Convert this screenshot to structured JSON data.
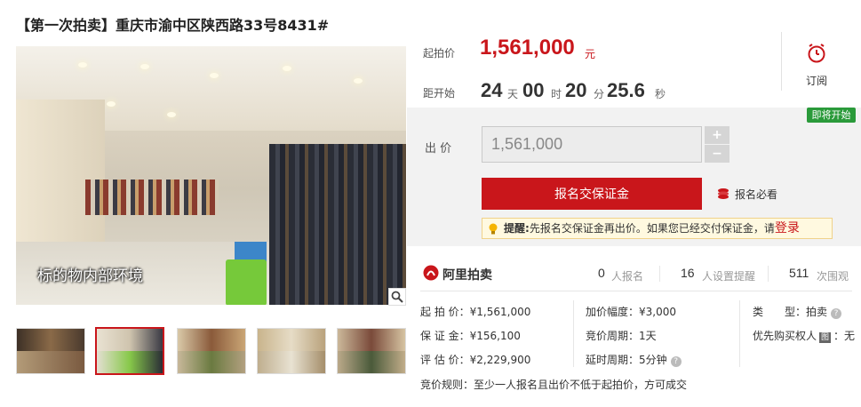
{
  "title": "【第一次拍卖】重庆市渝中区陕西路33号8431#",
  "photo": {
    "caption": "标的物内部环境"
  },
  "starting_price": {
    "label": "起拍价",
    "value": "1,561,000",
    "unit": "元"
  },
  "countdown": {
    "label": "距开始",
    "days": "24",
    "days_unit": "天",
    "hours": "00",
    "hours_unit": "时",
    "minutes": "20",
    "minutes_unit": "分",
    "seconds": "25.6",
    "seconds_unit": "秒"
  },
  "subscribe": {
    "label": "订阅",
    "icon": "alarm-clock-icon"
  },
  "status_badge": "即将开始",
  "bid": {
    "label": "出 价",
    "value": "1,561,000",
    "plus": "+",
    "minus": "−",
    "register_button": "报名交保证金",
    "must_see": "报名必看"
  },
  "tip": {
    "prefix": "提醒:",
    "text": "先报名交保证金再出价。如果您已经交付保证金，请",
    "login": "登录"
  },
  "platform": {
    "name": "阿里拍卖"
  },
  "stats": [
    {
      "num": "0",
      "label": "人报名"
    },
    {
      "num": "16",
      "label": "人设置提醒"
    },
    {
      "num": "511",
      "label": "次围观"
    }
  ],
  "details": {
    "start_price": {
      "k": "起 拍 价：",
      "v": "¥1,561,000"
    },
    "deposit": {
      "k": "保 证 金：",
      "v": "¥156,100"
    },
    "appraisal": {
      "k": "评 估 价：",
      "v": "¥2,229,900"
    },
    "increment": {
      "k": "加价幅度：",
      "v": "¥3,000"
    },
    "cycle": {
      "k": "竞价周期：",
      "v": "1天"
    },
    "extension": {
      "k": "延时周期：",
      "v": "5分钟"
    },
    "type": {
      "k": "类　　型：",
      "v": "拍卖"
    },
    "priority": {
      "k": "优先购买权人",
      "badge": "图",
      "v": "：无"
    },
    "rule": {
      "k": "竞价规则：",
      "v": "至少一人报名且出价不低于起拍价，方可成交"
    }
  },
  "colors": {
    "accent": "#c9161b",
    "badge": "#2a9a3a"
  }
}
